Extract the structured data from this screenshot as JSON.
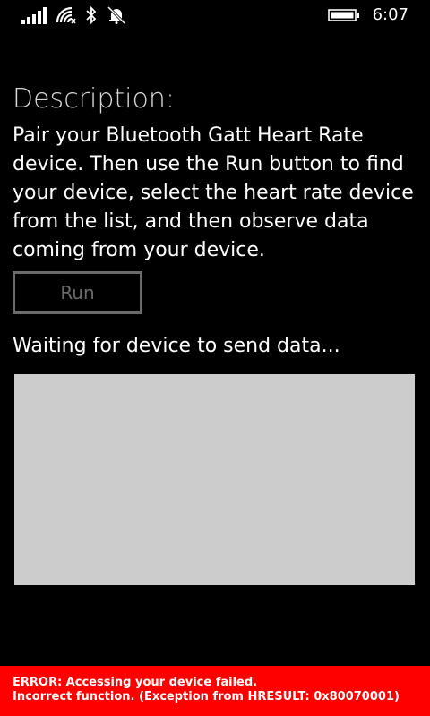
{
  "status_bar": {
    "time": "6:07",
    "icons": [
      "signal-icon",
      "wifi-icon",
      "bluetooth-icon",
      "quiet-hours-icon",
      "battery-icon"
    ]
  },
  "description": {
    "title": "Description:",
    "text": "Pair your Bluetooth Gatt Heart Rate device. Then use the Run button to find your device, select the heart rate device from the list, and then observe data coming from your device."
  },
  "run_button": {
    "label": "Run",
    "enabled": false
  },
  "status": {
    "text": "Waiting for device to send data..."
  },
  "error": {
    "line1": "ERROR: Accessing your device failed.",
    "line2": "Incorrect function. (Exception from HRESULT: 0x80070001)",
    "color": "#ff0000"
  },
  "colors": {
    "background": "#000000",
    "panel": "#cccccc",
    "disabled": "#6a6a6a"
  }
}
